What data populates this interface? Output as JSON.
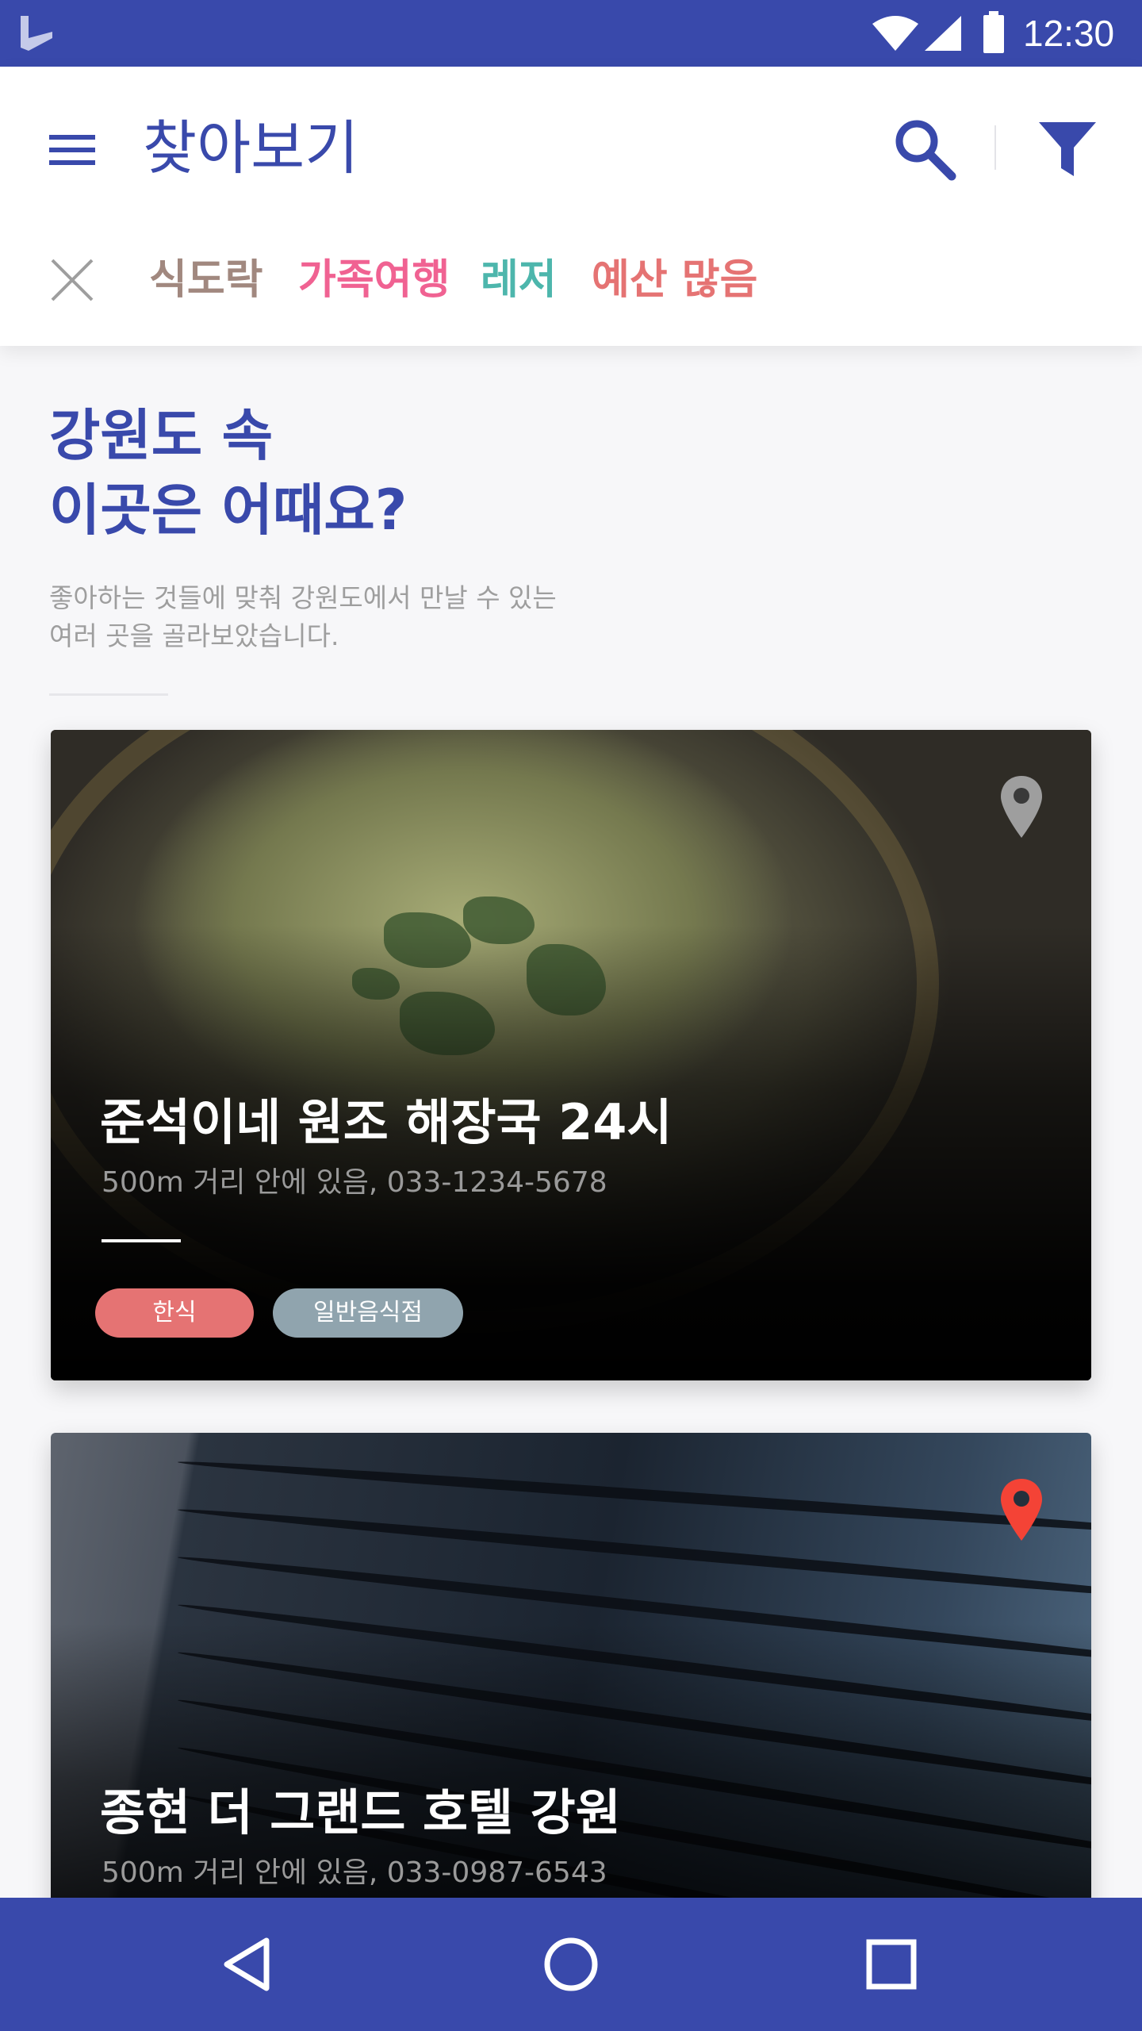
{
  "status_bar": {
    "time": "12:30",
    "icons": [
      "app-logo-icon",
      "wifi-icon",
      "signal-icon",
      "battery-icon"
    ]
  },
  "app_bar": {
    "title": "찾아보기",
    "icons": [
      "menu-icon",
      "search-icon",
      "filter-icon"
    ],
    "accent_color": "#3949ab"
  },
  "filters": {
    "close_icon": "close-icon",
    "chips": [
      {
        "label": "식도락",
        "color": "#a1887f"
      },
      {
        "label": "가족여행",
        "color": "#f06292"
      },
      {
        "label": "레저",
        "color": "#4db6ac"
      },
      {
        "label": "예산 많음",
        "color": "#e57373"
      }
    ]
  },
  "intro": {
    "title_line1": "강원도 속",
    "title_line2": "이곳은 어때요?",
    "desc_line1": "좋아하는 것들에 맞춰 강원도에서 만날 수 있는",
    "desc_line2": "여러 곳을 골라보았습니다."
  },
  "cards": [
    {
      "title": "준석이네 원조 해장국 24시",
      "subtitle": "500m  거리 안에 있음, 033-1234-5678",
      "pin_icon": "location-pin-icon",
      "pin_color": "#9e9e9e",
      "tags": [
        {
          "label": "한식",
          "color": "#e57373"
        },
        {
          "label": "일반음식점",
          "color": "#90a4ae"
        }
      ]
    },
    {
      "title": "종현 더 그랜드 호텔 강원",
      "subtitle": "500m  거리 안에 있음, 033-0987-6543",
      "pin_icon": "location-pin-icon",
      "pin_color": "#f44336"
    }
  ],
  "nav_bar": {
    "icons": [
      "back-icon",
      "home-icon",
      "recent-apps-icon"
    ]
  }
}
